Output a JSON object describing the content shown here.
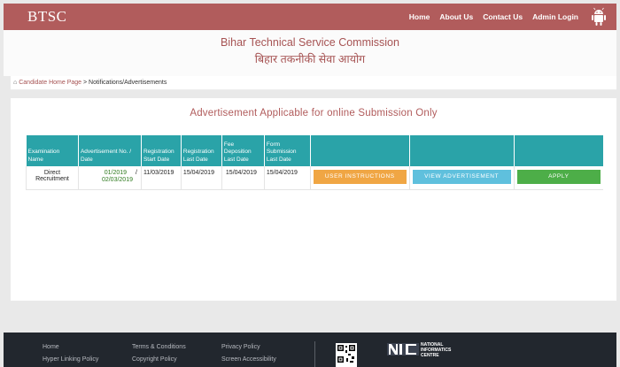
{
  "header": {
    "brand": "BTSC",
    "nav": [
      "Home",
      "About Us",
      "Contact Us",
      "Admin Login"
    ]
  },
  "banner": {
    "org_en": "Bihar Technical Service Commission",
    "org_hi": "बिहार तकनीकी सेवा आयोग"
  },
  "breadcrumb": {
    "home": "Candidate Home Page",
    "separator": " > ",
    "current": "Notifications/Advertisements"
  },
  "main": {
    "title": "Advertisement Applicable for online Submission Only"
  },
  "table": {
    "headers": [
      "Examination Name",
      "Advertisement No. / Date",
      "Registration Start Date",
      "Registration Last Date",
      "Fee Deposition Last Date",
      "Form Submission Last Date",
      "",
      "",
      ""
    ],
    "rows": [
      {
        "exam": "Direct Recruitment",
        "adv_no": "01/2019",
        "adv_sep": "/",
        "adv_date": "02/03/2019",
        "reg_start": "11/03/2019",
        "reg_last": "15/04/2019",
        "fee_last": "15/04/2019",
        "form_last": "15/04/2019",
        "btn_instructions": "USER INSTRUCTIONS",
        "btn_view": "VIEW ADVERTISEMENT",
        "btn_apply": "APPLY"
      }
    ]
  },
  "footer": {
    "col1": [
      "Home",
      "Hyper Linking Policy"
    ],
    "col2": [
      "Terms & Conditions",
      "Copyright Policy"
    ],
    "col3": [
      "Privacy Policy",
      "Screen Accessibility"
    ],
    "nic": [
      "NATIONAL",
      "INFORMATICS",
      "CENTRE"
    ]
  },
  "colors": {
    "header": "#b15c5c",
    "table_header": "#2aa3a8",
    "btn_instructions": "#f0a644",
    "btn_view": "#5fc0dd",
    "btn_apply": "#4dae48",
    "footer": "#22272e"
  },
  "icons": [
    "android-icon",
    "home-icon",
    "qr-code-icon",
    "nic-logo-icon"
  ]
}
